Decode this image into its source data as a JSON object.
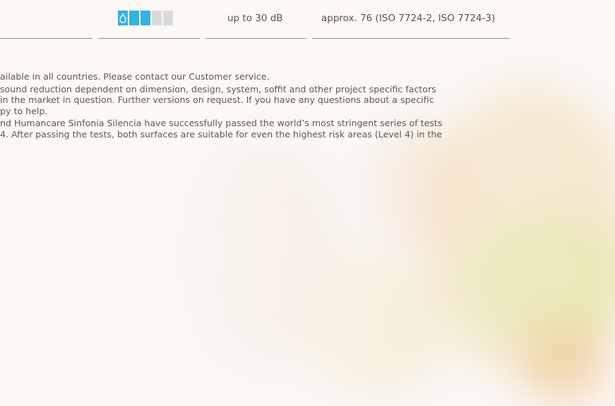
{
  "spec_row": {
    "meter": {
      "level": 3,
      "max": 5,
      "active_color": "#35b1e0",
      "inactive_color": "#dadada",
      "icon": "water-drop-icon"
    },
    "sound_reduction": "up to 30 dB",
    "iso_value": "approx. 76 (ISO 7724-2, ISO 7724-3)"
  },
  "footnotes": [
    {
      "lines": [
        "ailable in all countries. Please contact our Customer service."
      ]
    },
    {
      "lines": [
        "sound reduction dependent on dimension, design, system, soffit and other project specific factors",
        "in the market in question. Further versions on request. If you have any questions about a specific",
        "py to help."
      ]
    },
    {
      "lines": [
        "nd Humancare Sinfonia Silencia have successfully passed the world’s most stringent series of tests",
        "4. After passing the tests, both surfaces are suitable for even the highest risk areas (Level 4) in the"
      ]
    }
  ]
}
